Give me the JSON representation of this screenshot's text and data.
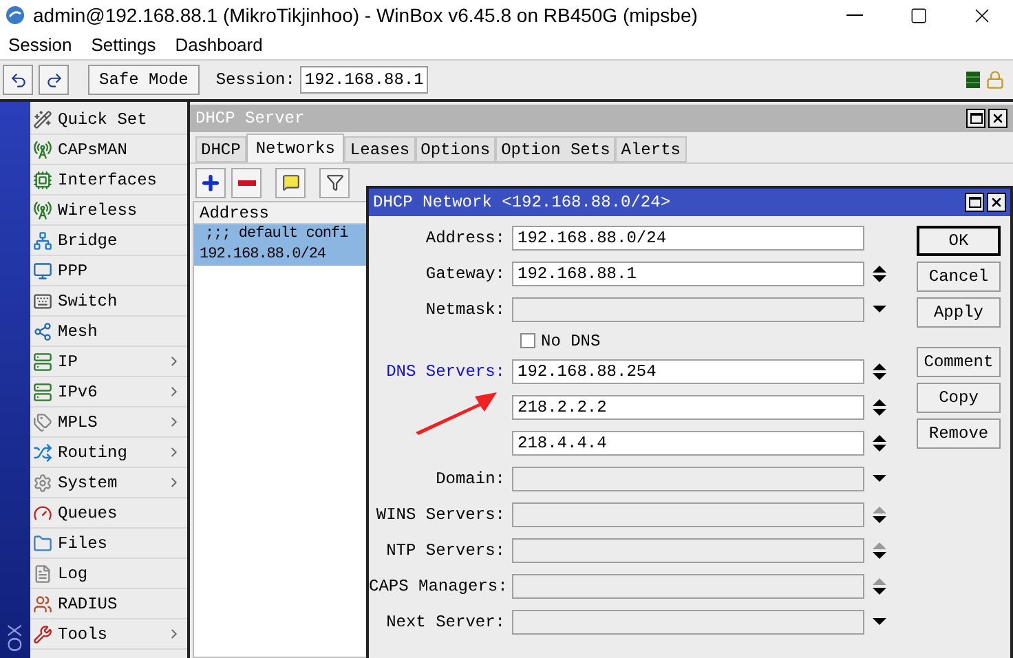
{
  "window": {
    "title": "admin@192.168.88.1 (MikroTikjinhoo) - WinBox v6.45.8 on RB450G (mipsbe)"
  },
  "menu": [
    "Session",
    "Settings",
    "Dashboard"
  ],
  "toolbar": {
    "safe_mode": "Safe Mode",
    "session_label": "Session:",
    "session_value": "192.168.88.1"
  },
  "brand_strip": "OX",
  "sidebar": {
    "items": [
      {
        "label": "Quick Set",
        "submenu": false
      },
      {
        "label": "CAPsMAN",
        "submenu": false
      },
      {
        "label": "Interfaces",
        "submenu": false
      },
      {
        "label": "Wireless",
        "submenu": false
      },
      {
        "label": "Bridge",
        "submenu": false
      },
      {
        "label": "PPP",
        "submenu": false
      },
      {
        "label": "Switch",
        "submenu": false
      },
      {
        "label": "Mesh",
        "submenu": false
      },
      {
        "label": "IP",
        "submenu": true
      },
      {
        "label": "IPv6",
        "submenu": true
      },
      {
        "label": "MPLS",
        "submenu": true
      },
      {
        "label": "Routing",
        "submenu": true
      },
      {
        "label": "System",
        "submenu": true
      },
      {
        "label": "Queues",
        "submenu": false
      },
      {
        "label": "Files",
        "submenu": false
      },
      {
        "label": "Log",
        "submenu": false
      },
      {
        "label": "RADIUS",
        "submenu": false
      },
      {
        "label": "Tools",
        "submenu": true
      }
    ]
  },
  "dhcp_server": {
    "title": "DHCP Server",
    "tabs": [
      {
        "label": "DHCP",
        "selected": false
      },
      {
        "label": "Networks",
        "selected": true
      },
      {
        "label": "Leases",
        "selected": false
      },
      {
        "label": "Options",
        "selected": false
      },
      {
        "label": "Option Sets",
        "selected": false
      },
      {
        "label": "Alerts",
        "selected": false
      }
    ],
    "table": {
      "columns": [
        "Address"
      ],
      "rows": [
        {
          "kind": "comment",
          "text": ";;; default confi",
          "selected": true
        },
        {
          "kind": "row",
          "text": "192.168.88.0/24",
          "selected": true
        }
      ]
    }
  },
  "dialog": {
    "title": "DHCP Network <192.168.88.0/24>",
    "fields": [
      {
        "kind": "field",
        "label": "Address:",
        "highlighted": false,
        "values": [
          "192.168.88.0/24"
        ],
        "enabled": true
      },
      {
        "kind": "field",
        "label": "Gateway:",
        "highlighted": false,
        "values": [
          "192.168.88.1"
        ],
        "enabled": true,
        "spinner": true,
        "up_disabled": false
      },
      {
        "kind": "field",
        "label": "Netmask:",
        "highlighted": false,
        "enabled": false,
        "dropdown": true
      },
      {
        "kind": "checkbox",
        "label": "No DNS",
        "checked": false
      },
      {
        "kind": "field",
        "label": "DNS Servers:",
        "highlighted": true,
        "values": [
          "192.168.88.254",
          "218.2.2.2",
          "218.4.4.4"
        ],
        "enabled": true,
        "spinner": true,
        "up_disabled": false
      },
      {
        "kind": "field",
        "label": "Domain:",
        "highlighted": false,
        "enabled": false,
        "dropdown": true
      },
      {
        "kind": "field",
        "label": "WINS Servers:",
        "highlighted": false,
        "enabled": false,
        "spinner": true,
        "up_disabled": true
      },
      {
        "kind": "field",
        "label": "NTP Servers:",
        "highlighted": false,
        "enabled": false,
        "spinner": true,
        "up_disabled": true
      },
      {
        "kind": "field",
        "label": "CAPS Managers:",
        "highlighted": false,
        "enabled": false,
        "spinner": true,
        "up_disabled": true
      },
      {
        "kind": "field",
        "label": "Next Server:",
        "highlighted": false,
        "enabled": false,
        "dropdown": true
      }
    ],
    "buttons": [
      {
        "label": "OK",
        "default": true
      },
      {
        "label": "Cancel",
        "default": false
      },
      {
        "label": "Apply",
        "default": false
      },
      {
        "label": "Comment",
        "default": false
      },
      {
        "label": "Copy",
        "default": false
      },
      {
        "label": "Remove",
        "default": false
      }
    ]
  }
}
